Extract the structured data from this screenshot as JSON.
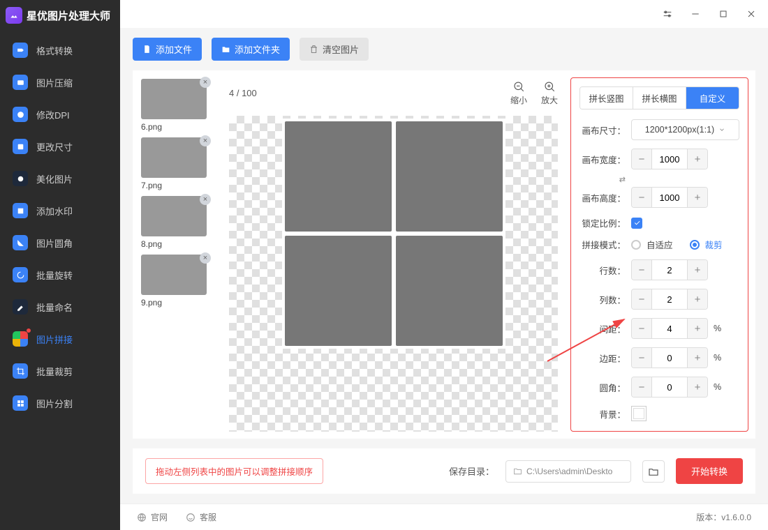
{
  "app": {
    "title": "星优图片处理大师"
  },
  "sidebar": {
    "items": [
      {
        "label": "格式转换"
      },
      {
        "label": "图片压缩"
      },
      {
        "label": "修改DPI"
      },
      {
        "label": "更改尺寸"
      },
      {
        "label": "美化图片"
      },
      {
        "label": "添加水印"
      },
      {
        "label": "图片圆角"
      },
      {
        "label": "批量旋转"
      },
      {
        "label": "批量命名"
      },
      {
        "label": "图片拼接"
      },
      {
        "label": "批量裁剪"
      },
      {
        "label": "图片分割"
      }
    ]
  },
  "toolbar": {
    "add_file": "添加文件",
    "add_folder": "添加文件夹",
    "clear": "清空图片"
  },
  "thumbs": [
    {
      "name": "6.png"
    },
    {
      "name": "7.png"
    },
    {
      "name": "8.png"
    },
    {
      "name": "9.png"
    }
  ],
  "canvas": {
    "count": "4 / 100",
    "zoom_out": "缩小",
    "zoom_in": "放大"
  },
  "panel": {
    "tabs": {
      "vertical": "拼长竖图",
      "horizontal": "拼长横图",
      "custom": "自定义"
    },
    "canvas_size_lbl": "画布尺寸：",
    "canvas_size_val": "1200*1200px(1:1)",
    "canvas_w_lbl": "画布宽度：",
    "canvas_w_val": "1000",
    "canvas_h_lbl": "画布高度：",
    "canvas_h_val": "1000",
    "lock_lbl": "锁定比例：",
    "mode_lbl": "拼接模式：",
    "mode_fit": "自适应",
    "mode_crop": "裁剪",
    "rows_lbl": "行数：",
    "rows_val": "2",
    "cols_lbl": "列数：",
    "cols_val": "2",
    "gap_lbl": "间距：",
    "gap_val": "4",
    "margin_lbl": "边距：",
    "margin_val": "0",
    "radius_lbl": "圆角：",
    "radius_val": "0",
    "bg_lbl": "背景：",
    "pct": "%"
  },
  "footer": {
    "hint": "拖动左侧列表中的图片可以调整拼接顺序",
    "save_lbl": "保存目录：",
    "save_path": "C:\\Users\\admin\\Deskto",
    "start": "开始转换"
  },
  "bottom": {
    "site": "官网",
    "support": "客服",
    "version": "版本：v1.6.0.0"
  }
}
